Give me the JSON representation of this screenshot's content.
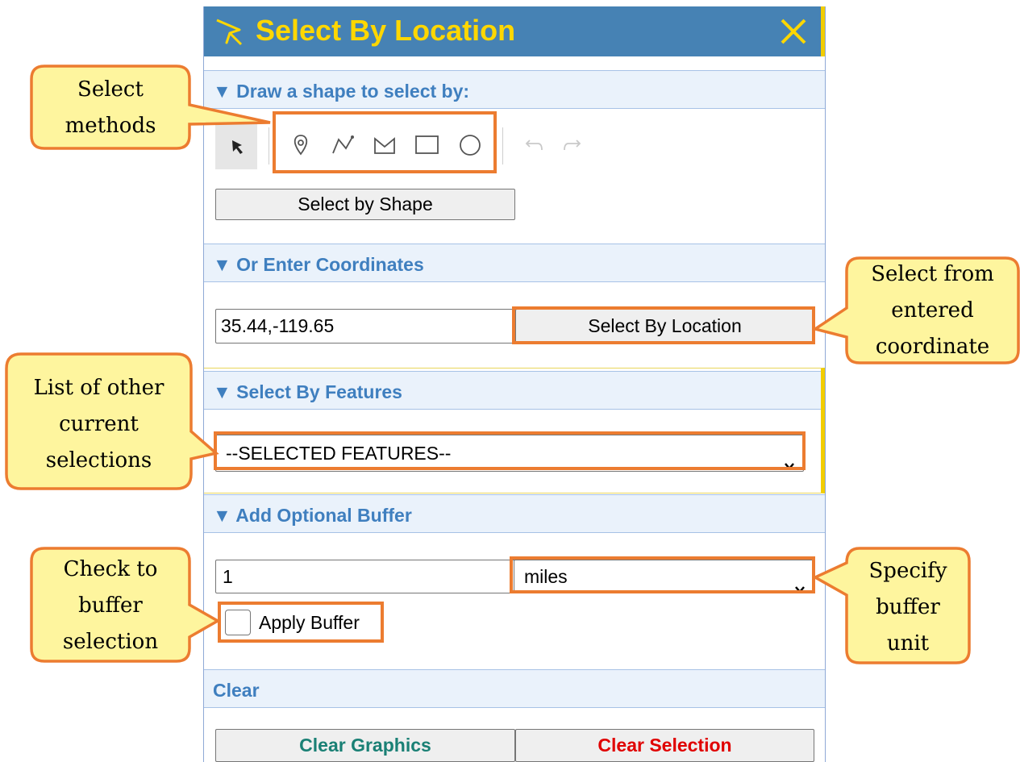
{
  "panel": {
    "title": "Select By Location",
    "title_icon": "cursor-select-icon",
    "close_icon": "close-icon"
  },
  "colors": {
    "titlebar": "#4682b4",
    "title_text": "#ffd700",
    "section_header_text": "#3f7fbf",
    "highlight_border": "#ec7c30",
    "callout_fill": "#fef59e",
    "clear_graphics_text": "#1a8075",
    "clear_selection_text": "#e00000"
  },
  "draw_section": {
    "header": "▼ Draw a shape to select by:",
    "tools": [
      "pointer-icon",
      "point-icon",
      "polyline-icon",
      "polygon-icon",
      "rectangle-icon",
      "circle-icon",
      "undo-icon",
      "redo-icon"
    ],
    "button": "Select by Shape"
  },
  "coord_section": {
    "header": "▼ Or Enter Coordinates",
    "input_value": "35.44,-119.65",
    "button": "Select By Location"
  },
  "features_section": {
    "header": "▼ Select By Features",
    "select_value": "--SELECTED FEATURES--"
  },
  "buffer_section": {
    "header": "▼ Add Optional Buffer",
    "distance_value": "1",
    "unit_value": "miles",
    "apply_label": "Apply Buffer"
  },
  "clear_section": {
    "header": "Clear",
    "graphics_button": "Clear Graphics",
    "selection_button": "Clear Selection"
  },
  "callouts": {
    "select_methods": [
      "Select",
      "methods"
    ],
    "select_from": [
      "Select from",
      "entered",
      "coordinate"
    ],
    "list_other": [
      "List of other",
      "current",
      "selections"
    ],
    "check_buffer": [
      "Check to",
      "buffer",
      "selection"
    ],
    "specify_unit": [
      "Specify",
      "buffer",
      "unit"
    ]
  }
}
